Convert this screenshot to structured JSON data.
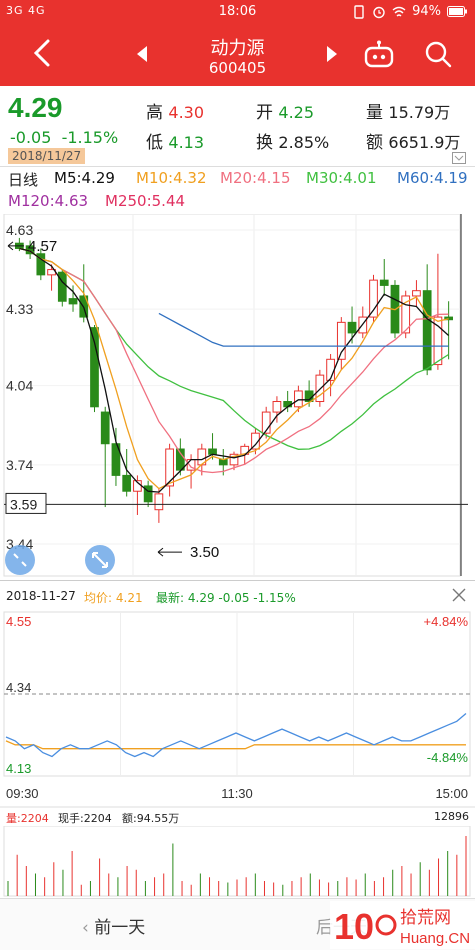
{
  "status_bar": {
    "signal": "3G 4G",
    "time": "18:06",
    "battery": "94%",
    "colors": {
      "bar": "#e8322e"
    }
  },
  "header": {
    "stock_name": "动力源",
    "stock_code": "600405",
    "icons": [
      "back-arrow-icon",
      "prev-stock-icon",
      "next-stock-icon",
      "robot-icon",
      "search-icon"
    ]
  },
  "quote": {
    "price": "4.29",
    "change": "-0.05",
    "change_pct": "-1.15%",
    "date": "2018/11/27",
    "high_label": "高",
    "high": "4.30",
    "open_label": "开",
    "open": "4.25",
    "volume_label": "量",
    "volume": "15.79万",
    "low_label": "低",
    "low": "4.13",
    "turnover_label": "换",
    "turnover": "2.85%",
    "amount_label": "额",
    "amount": "6651.9万"
  },
  "ma_legend": {
    "period": "日线",
    "ma5": "M5:4.29",
    "ma10": "M10:4.32",
    "ma20": "M20:4.15",
    "ma30": "M30:4.01",
    "ma60": "M60:4.19",
    "ma120": "M120:4.63",
    "ma250": "M250:5.44",
    "colors": {
      "ma5": "#111111",
      "ma10": "#f0a020",
      "ma20": "#f07080",
      "ma30": "#40c040",
      "ma60": "#3070c0",
      "ma120": "#a030a0",
      "ma250": "#e03060"
    }
  },
  "chart_data": [
    {
      "type": "candlestick",
      "title": "日线",
      "y_ticks": [
        "4.63",
        "4.33",
        "4.04",
        "3.74",
        "3.44"
      ],
      "ylim": [
        3.44,
        4.63
      ],
      "crosshair_value": "3.59",
      "annotations": {
        "high_mark": "4.57",
        "low_mark": "3.50"
      },
      "candles": [
        {
          "o": 4.58,
          "h": 4.6,
          "l": 4.55,
          "c": 4.56
        },
        {
          "o": 4.57,
          "h": 4.59,
          "l": 4.52,
          "c": 4.54
        },
        {
          "o": 4.54,
          "h": 4.56,
          "l": 4.44,
          "c": 4.46
        },
        {
          "o": 4.46,
          "h": 4.5,
          "l": 4.4,
          "c": 4.48
        },
        {
          "o": 4.47,
          "h": 4.48,
          "l": 4.34,
          "c": 4.36
        },
        {
          "o": 4.37,
          "h": 4.42,
          "l": 4.32,
          "c": 4.35
        },
        {
          "o": 4.38,
          "h": 4.5,
          "l": 4.28,
          "c": 4.3
        },
        {
          "o": 4.26,
          "h": 4.27,
          "l": 3.94,
          "c": 3.96
        },
        {
          "o": 3.94,
          "h": 3.96,
          "l": 3.58,
          "c": 3.82
        },
        {
          "o": 3.82,
          "h": 3.88,
          "l": 3.66,
          "c": 3.7
        },
        {
          "o": 3.7,
          "h": 3.8,
          "l": 3.62,
          "c": 3.64
        },
        {
          "o": 3.64,
          "h": 3.7,
          "l": 3.55,
          "c": 3.68
        },
        {
          "o": 3.66,
          "h": 3.68,
          "l": 3.58,
          "c": 3.6
        },
        {
          "o": 3.57,
          "h": 3.65,
          "l": 3.52,
          "c": 3.63
        },
        {
          "o": 3.66,
          "h": 3.82,
          "l": 3.62,
          "c": 3.8
        },
        {
          "o": 3.8,
          "h": 3.84,
          "l": 3.7,
          "c": 3.72
        },
        {
          "o": 3.72,
          "h": 3.78,
          "l": 3.65,
          "c": 3.76
        },
        {
          "o": 3.74,
          "h": 3.82,
          "l": 3.7,
          "c": 3.8
        },
        {
          "o": 3.8,
          "h": 3.86,
          "l": 3.76,
          "c": 3.78
        },
        {
          "o": 3.76,
          "h": 3.8,
          "l": 3.7,
          "c": 3.74
        },
        {
          "o": 3.74,
          "h": 3.79,
          "l": 3.72,
          "c": 3.78
        },
        {
          "o": 3.78,
          "h": 3.82,
          "l": 3.74,
          "c": 3.81
        },
        {
          "o": 3.8,
          "h": 3.88,
          "l": 3.78,
          "c": 3.86
        },
        {
          "o": 3.86,
          "h": 3.96,
          "l": 3.84,
          "c": 3.94
        },
        {
          "o": 3.94,
          "h": 4.0,
          "l": 3.9,
          "c": 3.98
        },
        {
          "o": 3.98,
          "h": 4.02,
          "l": 3.94,
          "c": 3.96
        },
        {
          "o": 3.96,
          "h": 4.04,
          "l": 3.94,
          "c": 4.02
        },
        {
          "o": 4.02,
          "h": 4.06,
          "l": 3.96,
          "c": 3.98
        },
        {
          "o": 3.98,
          "h": 4.1,
          "l": 3.96,
          "c": 4.08
        },
        {
          "o": 4.06,
          "h": 4.16,
          "l": 4.0,
          "c": 4.14
        },
        {
          "o": 4.14,
          "h": 4.3,
          "l": 4.1,
          "c": 4.28
        },
        {
          "o": 4.28,
          "h": 4.34,
          "l": 4.2,
          "c": 4.24
        },
        {
          "o": 4.24,
          "h": 4.34,
          "l": 4.22,
          "c": 4.3
        },
        {
          "o": 4.3,
          "h": 4.46,
          "l": 4.28,
          "c": 4.44
        },
        {
          "o": 4.44,
          "h": 4.52,
          "l": 4.38,
          "c": 4.42
        },
        {
          "o": 4.42,
          "h": 4.44,
          "l": 4.22,
          "c": 4.24
        },
        {
          "o": 4.24,
          "h": 4.4,
          "l": 4.22,
          "c": 4.38
        },
        {
          "o": 4.38,
          "h": 4.44,
          "l": 4.34,
          "c": 4.4
        },
        {
          "o": 4.4,
          "h": 4.5,
          "l": 4.08,
          "c": 4.1
        },
        {
          "o": 4.12,
          "h": 4.54,
          "l": 4.1,
          "c": 4.3
        },
        {
          "o": 4.3,
          "h": 4.36,
          "l": 4.14,
          "c": 4.29
        }
      ]
    },
    {
      "type": "line",
      "title": "分时",
      "date": "2018-11-27",
      "avg_label": "均价:",
      "avg_value": "4.21",
      "latest_label": "最新:",
      "latest_value": "4.29 -0.05 -1.15%",
      "y_top": "4.55",
      "y_mid": "4.34",
      "y_bottom": "4.13",
      "pct_top": "+4.84%",
      "pct_bottom": "-4.84%",
      "x_ticks": [
        "09:30",
        "11:30",
        "15:00"
      ],
      "ylim": [
        4.13,
        4.55
      ],
      "series": [
        {
          "name": "价格",
          "values": [
            4.23,
            4.22,
            4.2,
            4.21,
            4.19,
            4.18,
            4.2,
            4.21,
            4.2,
            4.2,
            4.21,
            4.22,
            4.21,
            4.19,
            4.18,
            4.19,
            4.18,
            4.2,
            4.21,
            4.22,
            4.21,
            4.2,
            4.21,
            4.22,
            4.23,
            4.24,
            4.23,
            4.22,
            4.23,
            4.24,
            4.25,
            4.24,
            4.23,
            4.22,
            4.23,
            4.22,
            4.23,
            4.24,
            4.23,
            4.22,
            4.21,
            4.22,
            4.23,
            4.22,
            4.22,
            4.23,
            4.24,
            4.25,
            4.26,
            4.27,
            4.29
          ]
        },
        {
          "name": "均价",
          "values": [
            4.22,
            4.21,
            4.21,
            4.21,
            4.2,
            4.2,
            4.2,
            4.2,
            4.2,
            4.2,
            4.2,
            4.2,
            4.2,
            4.2,
            4.2,
            4.2,
            4.2,
            4.2,
            4.2,
            4.2,
            4.2,
            4.2,
            4.2,
            4.2,
            4.2,
            4.2,
            4.2,
            4.21,
            4.21,
            4.21,
            4.21,
            4.21,
            4.21,
            4.21,
            4.21,
            4.21,
            4.21,
            4.21,
            4.21,
            4.21,
            4.21,
            4.21,
            4.21,
            4.21,
            4.21,
            4.21,
            4.21,
            4.21,
            4.21,
            4.21,
            4.21
          ]
        }
      ]
    },
    {
      "type": "bar",
      "title": "量",
      "volume_label": "量:2204",
      "hand_label": "现手:2204",
      "amount_label": "额:94.55万",
      "max_label": "12896",
      "values": [
        20,
        55,
        40,
        30,
        25,
        45,
        35,
        60,
        15,
        20,
        50,
        30,
        25,
        40,
        35,
        20,
        25,
        30,
        70,
        20,
        15,
        30,
        25,
        20,
        18,
        22,
        25,
        30,
        20,
        18,
        15,
        20,
        25,
        30,
        22,
        18,
        20,
        25,
        22,
        30,
        20,
        25,
        35,
        40,
        30,
        45,
        35,
        50,
        60,
        55,
        80
      ]
    }
  ],
  "bottom_bar": {
    "prev_day": "前一天",
    "next_day": "后一天",
    "watermark_text": "拾荒网",
    "watermark_domain": "Huang.CN",
    "watermark_number": "10"
  }
}
